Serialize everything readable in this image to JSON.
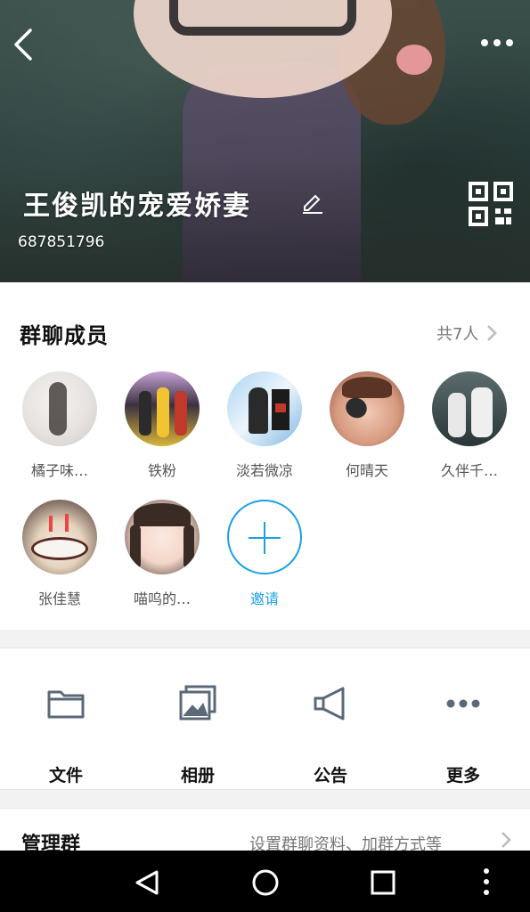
{
  "header": {
    "title": "王俊凯的宠爱娇妻",
    "group_id": "687851796",
    "icons": {
      "back": "back-arrow-icon",
      "more": "more-dots-icon",
      "edit": "edit-pencil-icon",
      "qr": "qr-code-icon"
    }
  },
  "members": {
    "title": "群聊成员",
    "count_label": "共7人",
    "items": [
      {
        "name": "橘子味…"
      },
      {
        "name": "铁粉"
      },
      {
        "name": "淡若微凉"
      },
      {
        "name": "何晴天"
      },
      {
        "name": "久伴千…"
      },
      {
        "name": "张佳慧"
      },
      {
        "name": "喵呜的…"
      }
    ],
    "invite_label": "邀请"
  },
  "tools": {
    "items": [
      {
        "label": "文件",
        "icon": "folder-icon"
      },
      {
        "label": "相册",
        "icon": "photo-album-icon"
      },
      {
        "label": "公告",
        "icon": "megaphone-icon"
      },
      {
        "label": "更多",
        "icon": "more-dots-icon"
      }
    ]
  },
  "manage": {
    "title": "管理群",
    "description": "设置群聊资料、加群方式等"
  },
  "colors": {
    "accent": "#1aa0e6",
    "navbar": "#000000"
  }
}
